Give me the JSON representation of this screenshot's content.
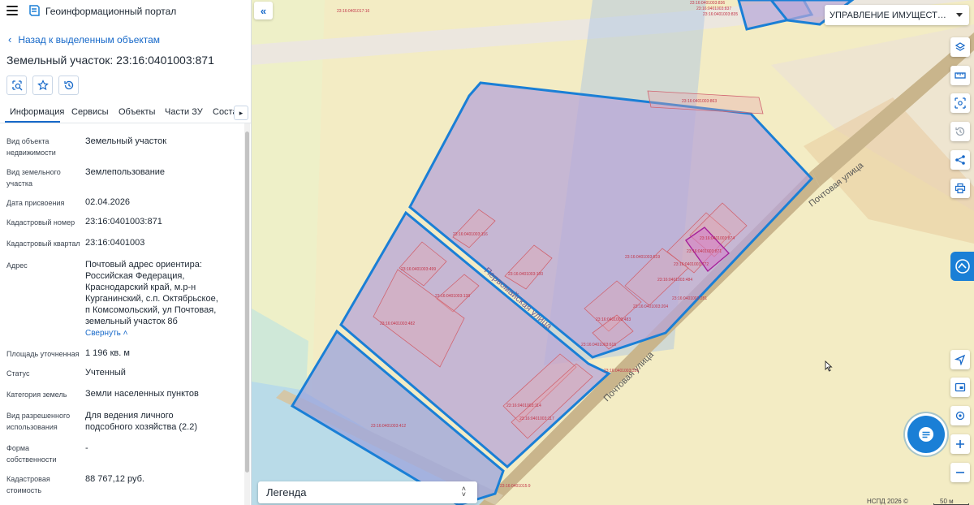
{
  "app": {
    "title": "Геоинформационный портал"
  },
  "panel": {
    "back_label": "Назад к выделенным объектам",
    "object_title": "Земельный участок: 23:16:0401003:871",
    "tabs": [
      "Информация",
      "Сервисы",
      "Объекты",
      "Части ЗУ",
      "Соста"
    ],
    "properties": [
      {
        "label": "Вид объекта недвижимости",
        "value": "Земельный участок"
      },
      {
        "label": "Вид земельного участка",
        "value": "Землепользование"
      },
      {
        "label": "Дата присвоения",
        "value": "02.04.2026"
      },
      {
        "label": "Кадастровый номер",
        "value": "23:16:0401003:871"
      },
      {
        "label": "Кадастровый квартал",
        "value": "23:16:0401003"
      },
      {
        "label": "Адрес",
        "value": "Почтовый адрес ориентира: Российская Федерация, Краснодарский край, м.р-н Курганинский, с.п. Октябрьское, п Комсомольский, ул Почтовая, земельный участок 8б"
      },
      {
        "label": "Площадь уточненная",
        "value": "1 196 кв. м"
      },
      {
        "label": "Статус",
        "value": "Учтенный"
      },
      {
        "label": "Категория земель",
        "value": "Земли населенных пунктов"
      },
      {
        "label": "Вид разрешенного использования",
        "value": "Для ведения личного подсобного хозяйства (2.2)"
      },
      {
        "label": "Форма собственности",
        "value": "-"
      },
      {
        "label": "Кадастровая стоимость",
        "value": "88 767,12 руб."
      }
    ],
    "collapse_label": "Свернуть"
  },
  "map": {
    "layer_select": "УПРАВЛЕНИЕ ИМУЩЕСТВЕННЫМИ",
    "legend_label": "Легенда",
    "copyright": "НСПД 2026 ©",
    "scale": "50 м",
    "streets": [
      "Почтовая улица",
      "Почтовая улица",
      "Первомайская улица"
    ],
    "parcel_labels": [
      "23:16:0401017:16",
      "23:16:0401003:863",
      "23:16:0401003:836",
      "23:16:0401003:837",
      "23:16:0401003:835",
      "23:16:0401003:116",
      "23:16:0401003:499",
      "23:16:0401003:100",
      "23:16:0401003:139",
      "23:16:0401003:519",
      "23:16:0401003:874",
      "23:16:0401003:871",
      "23:16:0401003:772",
      "23:16:0401003:484",
      "23:16:0401003:281",
      "23:16:0401003:204",
      "23:16:0401003:483",
      "23:16:0401003:412",
      "23:16:0401003:615",
      "23:16:0401003:321",
      "23:16:0401003:114",
      "23:16:0401003:117",
      "23:16:0401003:482",
      "23:16:0401015:9"
    ],
    "colors": {
      "parcel_fill": "#b7a6d8",
      "parcel_stroke": "#1a7fd6",
      "road": "#c8b48a",
      "accent": "#1769c9"
    }
  }
}
